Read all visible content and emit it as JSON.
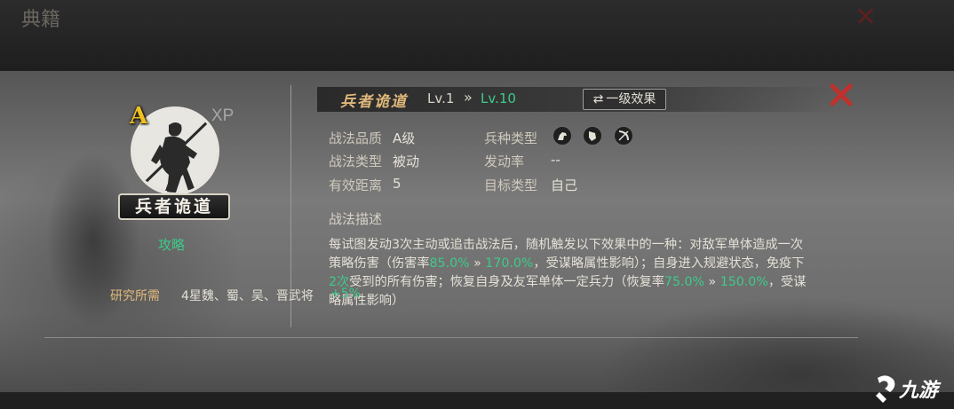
{
  "window": {
    "title": "典籍"
  },
  "portrait": {
    "grade": "A",
    "xp_label": "XP",
    "name": "兵者诡道",
    "strategy_link": "攻略"
  },
  "skill": {
    "name": "兵者诡道",
    "level_current": "Lv.1",
    "level_arrow": "»",
    "level_max": "Lv.10",
    "effect_button_label": "一级效果"
  },
  "fields": {
    "quality_label": "战法品质",
    "quality_value": "A级",
    "type_label": "战法类型",
    "type_value": "被动",
    "range_label": "有效距离",
    "range_value": "5",
    "troop_label": "兵种类型",
    "troop_icons": [
      "cavalry-icon",
      "shield-icon",
      "bow-icon"
    ],
    "trigger_label": "发动率",
    "trigger_value": "--",
    "target_label": "目标类型",
    "target_value": "自己"
  },
  "description": {
    "heading": "战法描述",
    "parts": [
      "每试图发动3次主动或追击战法后，随机触发以下效果中的一种：对敌军单体造成一次策略伤害（伤害率",
      "85.0%",
      " » ",
      "170.0%",
      "，受谋略属性影响）；自身进入规避状态，免疫下",
      "2次",
      "受到的所有伤害；恢复自身及友军单体一定兵力（恢复率",
      "75.0%",
      " » ",
      "150.0%",
      "，受谋略属性影响）"
    ]
  },
  "research": {
    "label": "研究所需",
    "value": "4星魏、蜀、吴、晋武将",
    "bonus": "+5%"
  },
  "watermark": {
    "text": "九游"
  },
  "colors": {
    "accent_green": "#3dcb8a",
    "title_gold": "#e0b87a",
    "grade_gold": "#f0c020",
    "close_red": "#c0302c"
  }
}
